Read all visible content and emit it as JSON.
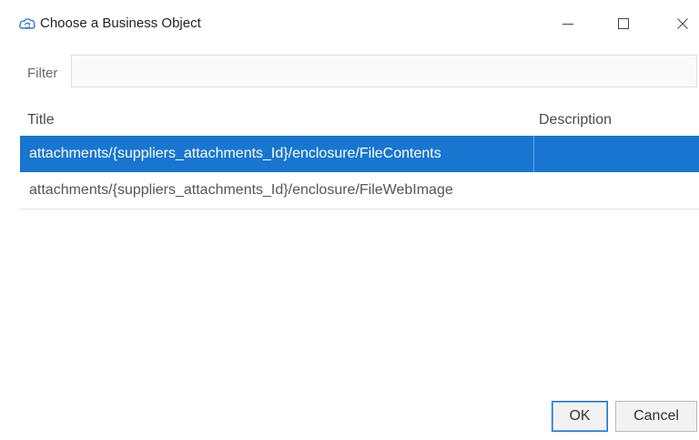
{
  "window": {
    "title": "Choose a Business Object",
    "app_icon": "cloud-sync-icon",
    "controls": {
      "minimize": "minimize-icon",
      "maximize": "maximize-icon",
      "close": "close-icon"
    }
  },
  "filter": {
    "label": "Filter",
    "value": "",
    "placeholder": ""
  },
  "table": {
    "columns": {
      "title": "Title",
      "description": "Description"
    },
    "rows": [
      {
        "title": "attachments/{suppliers_attachments_Id}/enclosure/FileContents",
        "description": "",
        "selected": true
      },
      {
        "title": "attachments/{suppliers_attachments_Id}/enclosure/FileWebImage",
        "description": "",
        "selected": false
      }
    ]
  },
  "buttons": {
    "ok": "OK",
    "cancel": "Cancel"
  },
  "colors": {
    "selection": "#1876d1",
    "ok_border": "#1b74d6",
    "icon_blue": "#2f7fd4"
  }
}
